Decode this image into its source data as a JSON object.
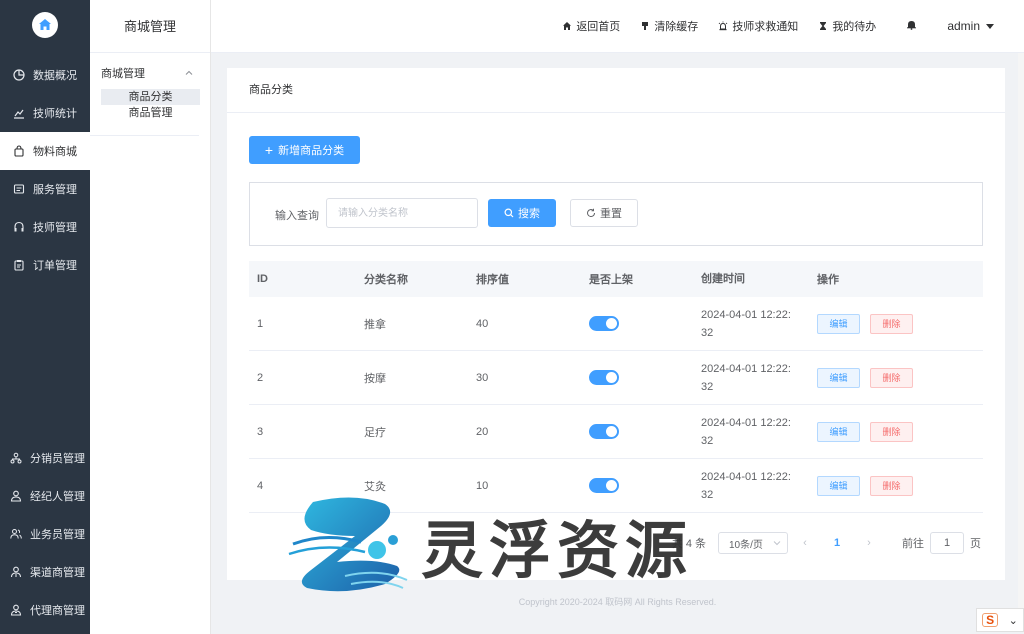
{
  "leftnav": {
    "top_items": [
      {
        "label": "数据概况",
        "icon": "pie-chart-icon"
      },
      {
        "label": "技师统计",
        "icon": "line-chart-icon"
      },
      {
        "label": "物料商城",
        "icon": "shopping-bag-icon",
        "active": true
      },
      {
        "label": "服务管理",
        "icon": "service-icon"
      },
      {
        "label": "技师管理",
        "icon": "headset-icon"
      },
      {
        "label": "订单管理",
        "icon": "clipboard-icon"
      }
    ],
    "bottom_items": [
      {
        "label": "分销员管理",
        "icon": "network-icon"
      },
      {
        "label": "经纪人管理",
        "icon": "user-icon"
      },
      {
        "label": "业务员管理",
        "icon": "users-icon"
      },
      {
        "label": "渠道商管理",
        "icon": "channel-icon"
      },
      {
        "label": "代理商管理",
        "icon": "agent-icon"
      }
    ]
  },
  "subnav": {
    "title": "商城管理",
    "group_label": "商城管理",
    "links": [
      "商品分类",
      "商品管理"
    ]
  },
  "topbar": {
    "links": [
      {
        "label": "返回首页",
        "icon": "home-icon"
      },
      {
        "label": "清除缓存",
        "icon": "brush-icon"
      },
      {
        "label": "技师求救通知",
        "icon": "alarm-icon"
      },
      {
        "label": "我的待办",
        "icon": "hourglass-icon"
      }
    ],
    "user": "admin"
  },
  "card": {
    "title": "商品分类",
    "add_button": "新增商品分类"
  },
  "search": {
    "label": "输入查询",
    "placeholder": "请输入分类名称",
    "search_button": "搜索",
    "reset_button": "重置"
  },
  "table": {
    "headers": [
      "ID",
      "分类名称",
      "排序值",
      "是否上架",
      "创建时间",
      "操作"
    ],
    "rows": [
      {
        "id": "1",
        "name": "推拿",
        "sort": "40",
        "on": true,
        "time_line1": "2024-04-01 12:22:",
        "time_line2": "32"
      },
      {
        "id": "2",
        "name": "按摩",
        "sort": "30",
        "on": true,
        "time_line1": "2024-04-01 12:22:",
        "time_line2": "32"
      },
      {
        "id": "3",
        "name": "足疗",
        "sort": "20",
        "on": true,
        "time_line1": "2024-04-01 12:22:",
        "time_line2": "32"
      },
      {
        "id": "4",
        "name": "艾灸",
        "sort": "10",
        "on": true,
        "time_line1": "2024-04-01 12:22:",
        "time_line2": "32"
      }
    ],
    "edit_label": "编辑",
    "delete_label": "删除"
  },
  "pager": {
    "total": "共 4 条",
    "page_size": "10条/页",
    "current_page": "1",
    "goto_prefix": "前往",
    "goto_value": "1",
    "goto_suffix": "页"
  },
  "footer": "Copyright 2020-2024 取码网 All Rights Reserved.",
  "watermark": "灵浮资源",
  "colors": {
    "primary": "#409eff",
    "sidebar": "#2b3643",
    "danger": "#f56c6c"
  }
}
